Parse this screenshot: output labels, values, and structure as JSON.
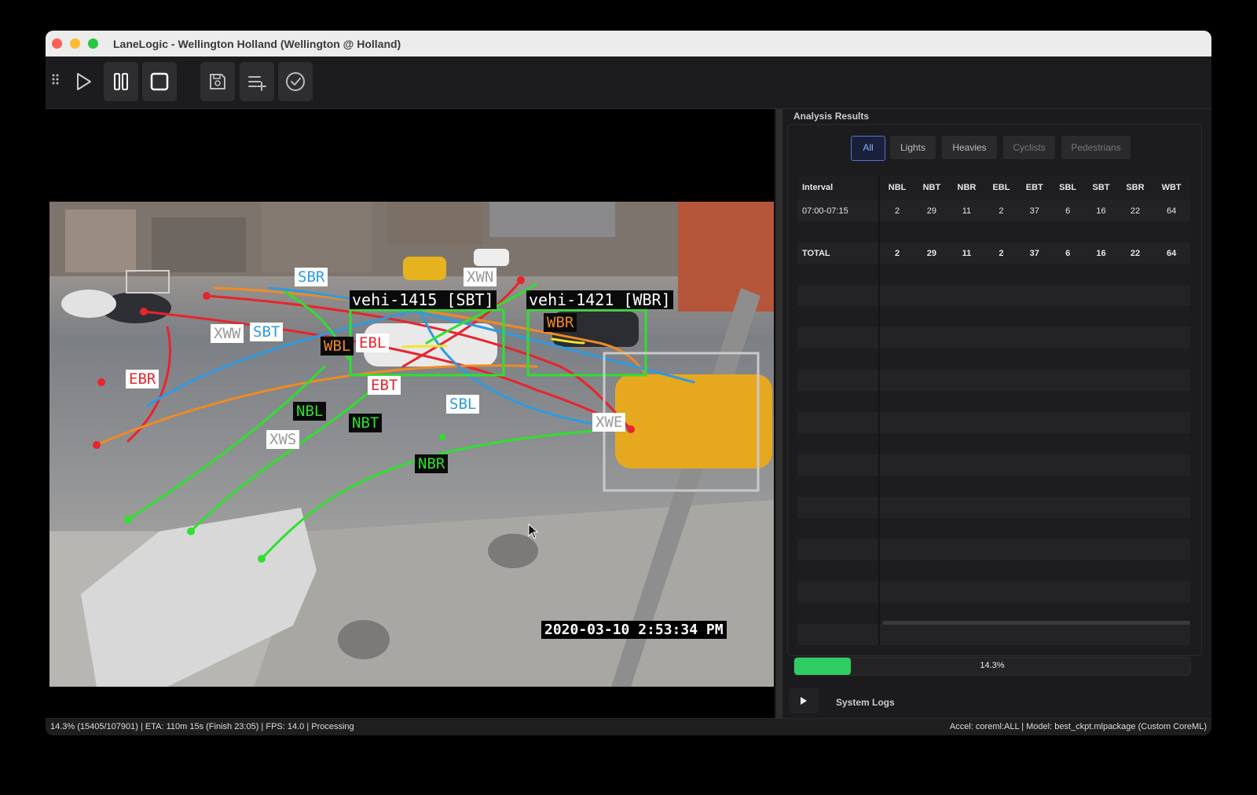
{
  "window": {
    "title": "LaneLogic - Wellington Holland (Wellington @ Holland)"
  },
  "toolbar": {
    "buttons": [
      {
        "icon": "play-icon",
        "label": "Play"
      },
      {
        "icon": "pause-icon",
        "label": "Pause"
      },
      {
        "icon": "stop-icon",
        "label": "Stop"
      },
      {
        "icon": "save-icon",
        "label": "Save"
      },
      {
        "icon": "playlist-add-icon",
        "label": "Add to queue"
      },
      {
        "icon": "check-circle-icon",
        "label": "Validate"
      }
    ]
  },
  "video": {
    "timestamp": "2020-03-10 2:53:34 PM",
    "detections": [
      {
        "label": "vehi-1415 [SBT]",
        "color": "#2fe02f"
      },
      {
        "label": "vehi-1421 [WBR]",
        "color": "#2fe02f"
      }
    ],
    "movement_labels": {
      "SBR": "SBR",
      "XWN": "XWN",
      "XWW": "XWW",
      "SBT": "SBT",
      "WBL": "WBL",
      "EBL": "EBL",
      "WBR": "WBR",
      "EBR": "EBR",
      "EBT": "EBT",
      "SBL": "SBL",
      "NBL": "NBL",
      "NBT": "NBT",
      "XWS": "XWS",
      "XWE": "XWE",
      "NBR": "NBR"
    },
    "colors": {
      "red": "#e8242c",
      "green": "#2fe02f",
      "blue": "#2c9be3",
      "orange": "#f08a24",
      "yellow": "#f3e52a"
    }
  },
  "analysis": {
    "title": "Analysis Results",
    "tabs": [
      "All",
      "Lights",
      "Heavies",
      "Cyclists",
      "Pedestrians"
    ],
    "active_tab": "All",
    "columns": [
      "Interval",
      "NBL",
      "NBT",
      "NBR",
      "EBL",
      "EBT",
      "SBL",
      "SBT",
      "SBR",
      "WBT"
    ],
    "rows": [
      [
        "07:00-07:15",
        "2",
        "29",
        "11",
        "2",
        "37",
        "6",
        "16",
        "22",
        "64"
      ],
      [
        "",
        "",
        "",
        "",
        "",
        "",
        "",
        "",
        "",
        ""
      ],
      [
        "TOTAL",
        "2",
        "29",
        "11",
        "2",
        "37",
        "6",
        "16",
        "22",
        "64"
      ]
    ],
    "empty_rows": 18,
    "progress": {
      "value": 0.143,
      "label": "14.3%",
      "color": "#2fcc62"
    }
  },
  "logs": {
    "label": "System Logs"
  },
  "status": {
    "left": "14.3% (15405/107901) | ETA: 110m 15s (Finish 23:05) | FPS: 14.0 | Processing",
    "right": "Accel: coreml:ALL | Model: best_ckpt.mlpackage (Custom CoreML)"
  }
}
